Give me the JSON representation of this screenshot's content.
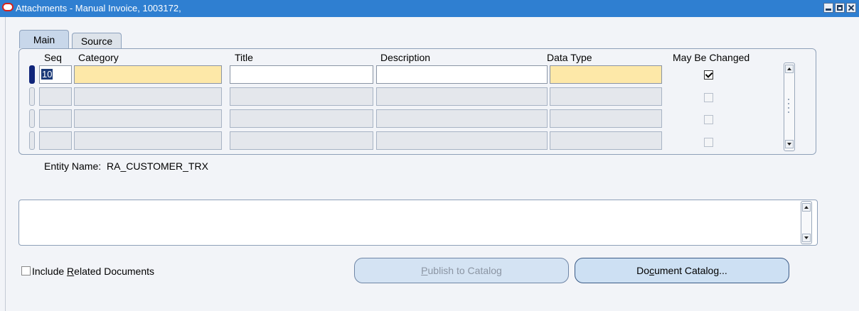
{
  "window": {
    "title": "Attachments - Manual Invoice, 1003172,",
    "titlebar_color": "#2f7fd1"
  },
  "tabs": [
    {
      "label": "Main",
      "active": true
    },
    {
      "label": "Source",
      "active": false
    }
  ],
  "table": {
    "columns": {
      "seq": "Seq",
      "category": "Category",
      "title": "Title",
      "description": "Description",
      "data_type": "Data Type",
      "may_be_changed": "May Be Changed"
    },
    "rows": [
      {
        "seq": "10",
        "category": "",
        "title": "",
        "description": "",
        "data_type": "",
        "may_be_changed": true
      },
      {
        "seq": "",
        "category": "",
        "title": "",
        "description": "",
        "data_type": "",
        "may_be_changed": false
      },
      {
        "seq": "",
        "category": "",
        "title": "",
        "description": "",
        "data_type": "",
        "may_be_changed": false
      },
      {
        "seq": "",
        "category": "",
        "title": "",
        "description": "",
        "data_type": "",
        "may_be_changed": false
      }
    ],
    "required_field_color": "#fde8a8"
  },
  "entity": {
    "label": "Entity Name:",
    "value": "RA_CUSTOMER_TRX"
  },
  "include_related": {
    "checked": false,
    "label_pre": "Include ",
    "label_mnemonic": "R",
    "label_post": "elated Documents"
  },
  "buttons": {
    "publish": {
      "pre": "",
      "mnemonic": "P",
      "post": "ublish to Catalog",
      "enabled": false
    },
    "catalog": {
      "pre": "Do",
      "mnemonic": "c",
      "post": "ument Catalog...",
      "enabled": true
    }
  }
}
